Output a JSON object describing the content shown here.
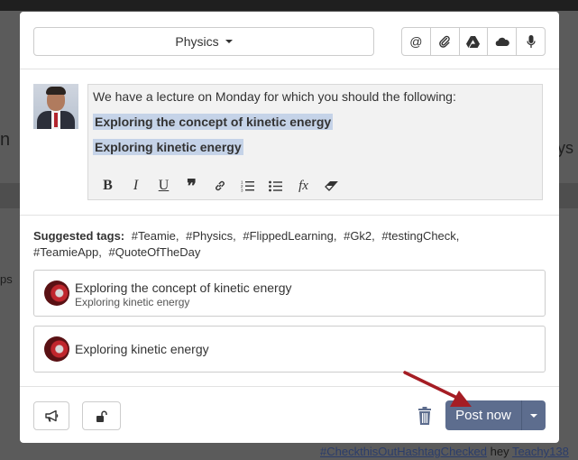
{
  "background": {
    "left_text": "n",
    "left_text2": "ps",
    "right_text": "ys",
    "bottom_link": "#CheckthisOutHashtagChecked",
    "bottom_text": " hey ",
    "bottom_link2": "Teachy138"
  },
  "composer": {
    "class_selector": "Physics",
    "tools": [
      {
        "icon": "at-icon",
        "glyph": "@"
      },
      {
        "icon": "paperclip-icon"
      },
      {
        "icon": "google-drive-icon"
      },
      {
        "icon": "onedrive-icon"
      },
      {
        "icon": "microphone-icon"
      }
    ],
    "editor": {
      "line1": "We have a lecture on Monday for which you should the following:",
      "line2": "Exploring the concept of kinetic energy",
      "line3": "Exploring kinetic energy",
      "format_buttons": [
        {
          "icon": "bold-icon",
          "glyph": "B"
        },
        {
          "icon": "italic-icon",
          "glyph": "I"
        },
        {
          "icon": "underline-icon",
          "glyph": "U"
        },
        {
          "icon": "quote-icon",
          "glyph": "❞"
        },
        {
          "icon": "link-icon"
        },
        {
          "icon": "ordered-list-icon"
        },
        {
          "icon": "bullet-list-icon"
        },
        {
          "icon": "formula-icon",
          "glyph": "fx"
        },
        {
          "icon": "eraser-icon"
        }
      ]
    },
    "suggested_tags": {
      "label": "Suggested tags:",
      "tags": [
        "#Teamie,",
        "#Physics,",
        "#FlippedLearning,",
        "#Gk2,",
        "#testingCheck,",
        "#TeamieApp,",
        "#QuoteOfTheDay"
      ]
    },
    "attachments": [
      {
        "title": "Exploring the concept of kinetic energy",
        "subtitle": "Exploring kinetic energy"
      },
      {
        "title": "Exploring kinetic energy",
        "subtitle": ""
      }
    ],
    "footer": {
      "post_label": "Post now"
    },
    "colors": {
      "post_button": "#5d6d8e",
      "highlight": "#c5d3e8",
      "arrow": "#a51d24"
    }
  }
}
